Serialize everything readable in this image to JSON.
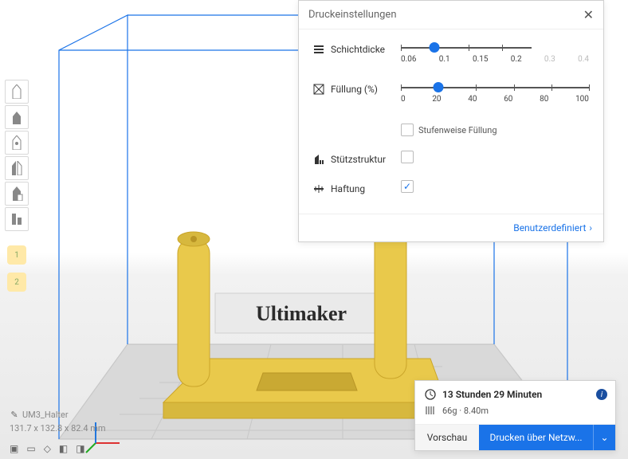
{
  "panel": {
    "title": "Druckeinstellungen",
    "layer": {
      "label": "Schichtdicke",
      "ticks": [
        "0.06",
        "0.1",
        "0.15",
        "0.2",
        "0.3",
        "0.4"
      ],
      "value": "0.1"
    },
    "infill": {
      "label": "Füllung (%)",
      "ticks": [
        "0",
        "20",
        "40",
        "60",
        "80",
        "100"
      ],
      "value": "20",
      "gradual_label": "Stufenweise Füllung",
      "gradual_checked": false
    },
    "support": {
      "label": "Stützstruktur",
      "checked": false
    },
    "adhesion": {
      "label": "Haftung",
      "checked": true
    },
    "custom_link": "Benutzerdefiniert"
  },
  "object": {
    "name": "UM3_Halter",
    "dimensions": "131.7 x 132.8 x 82.4 mm"
  },
  "brand_text": "Ultimaker",
  "print": {
    "time": "13 Stunden 29 Minuten",
    "material": "66g · 8.40m",
    "preview_label": "Vorschau",
    "main_label": "Drucken über Netzw..."
  },
  "icons": {
    "layer": "layer-height-icon",
    "infill": "infill-icon",
    "support": "support-icon",
    "adhesion": "adhesion-icon",
    "clock": "clock-icon",
    "spool": "spool-icon"
  }
}
